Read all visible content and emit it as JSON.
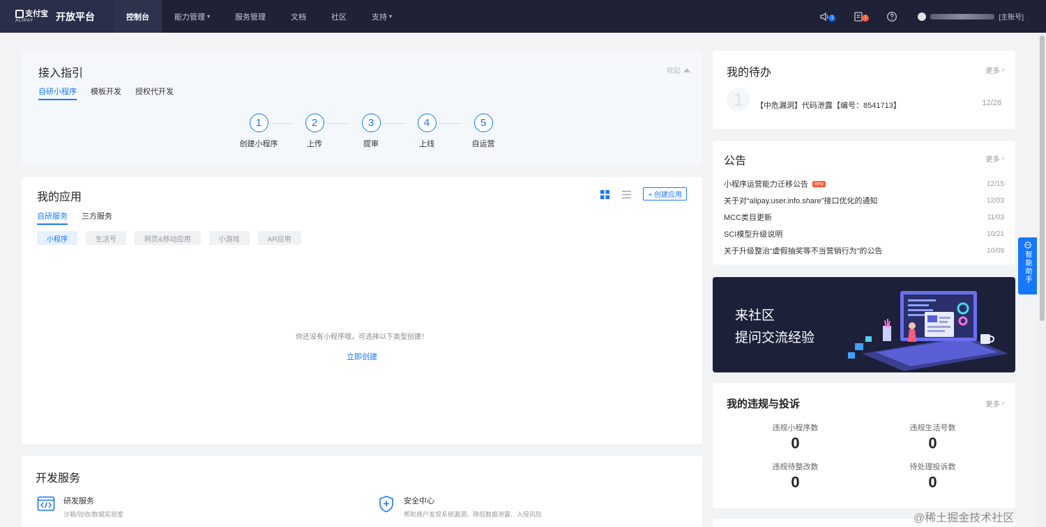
{
  "nav": {
    "brand_cn": "支付宝",
    "brand_en": "ALIPAY",
    "brand_title": "开放平台",
    "items": [
      {
        "label": "控制台",
        "caret": ""
      },
      {
        "label": "能力管理",
        "caret": "▾"
      },
      {
        "label": "服务管理",
        "caret": ""
      },
      {
        "label": "文档",
        "caret": ""
      },
      {
        "label": "社区",
        "caret": ""
      },
      {
        "label": "支持",
        "caret": "▾"
      }
    ],
    "badges": {
      "messages": "1",
      "tasks": "1"
    },
    "account_label": "[主账号]"
  },
  "guide": {
    "title": "接入指引",
    "collapse": "收起",
    "tabs": [
      "自研小程序",
      "模板开发",
      "授权代开发"
    ],
    "steps": [
      {
        "num": "1",
        "label": "创建小程序"
      },
      {
        "num": "2",
        "label": "上传"
      },
      {
        "num": "3",
        "label": "提审"
      },
      {
        "num": "4",
        "label": "上线"
      },
      {
        "num": "5",
        "label": "自运营"
      }
    ]
  },
  "apps": {
    "title": "我的应用",
    "create_label": "+ 创建应用",
    "tabs": [
      "自研服务",
      "三方服务"
    ],
    "chips": [
      "小程序",
      "生活号",
      "网页&移动应用",
      "小游戏",
      "AR应用"
    ],
    "empty_text": "你还没有小程序哦，可选择以下类型创建！",
    "create_now": "立即创建"
  },
  "dev": {
    "title": "开发服务",
    "items": [
      {
        "name": "研发服务",
        "desc": "沙箱/验收/数据实验室"
      },
      {
        "name": "安全中心",
        "desc": "帮助商户发现系统漏洞、降低数据泄露、入侵风险"
      }
    ]
  },
  "todo": {
    "title": "我的待办",
    "more": "更多",
    "num": "1",
    "text": "【中危漏洞】代码泄露【编号：8541713】",
    "date": "12/28"
  },
  "notice": {
    "title": "公告",
    "more": "更多",
    "new_badge": "new",
    "items": [
      {
        "text": "小程序运营能力迁移公告",
        "date": "12/15"
      },
      {
        "text": "关于对“alipay.user.info.share”接口优化的通知",
        "date": "12/03"
      },
      {
        "text": "MCC类目更新",
        "date": "11/03"
      },
      {
        "text": "SCI模型升级说明",
        "date": "10/21"
      },
      {
        "text": "关于升级整治“虚假抽奖等不当营销行为”的公告",
        "date": "10/09"
      }
    ]
  },
  "banner": {
    "line1": "来社区",
    "line2": "提问交流经验"
  },
  "violation": {
    "title": "我的违规与投诉",
    "more": "更多",
    "items": [
      {
        "label": "违规小程序数",
        "value": "0"
      },
      {
        "label": "违规生活号数",
        "value": "0"
      },
      {
        "label": "违规待整改数",
        "value": "0"
      },
      {
        "label": "待处理投诉数",
        "value": "0"
      }
    ]
  },
  "assistant": "智能助手",
  "watermark": "@稀土掘金技术社区",
  "colors": {
    "nav_bg": "#1f2237",
    "accent": "#1677ff",
    "badge": "#ff5a36",
    "badge_blue": "#1677ff"
  }
}
